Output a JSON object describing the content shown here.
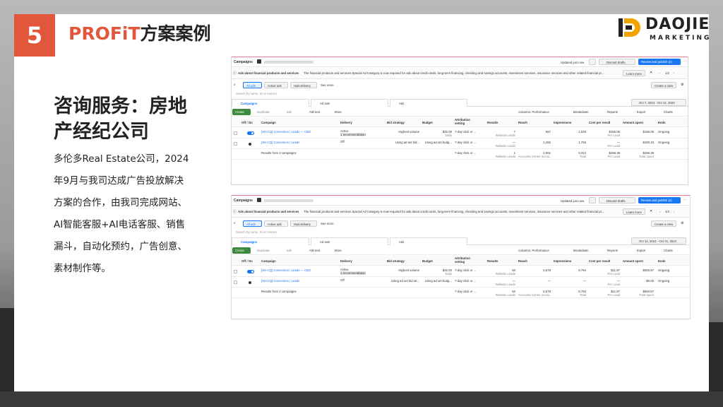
{
  "slide": {
    "number": "5",
    "title_brand": "PROFiT",
    "title_rest": "方案案例",
    "heading_line1": "咨询服务：房地",
    "heading_line2": "产经纪公司",
    "body_lines": [
      "多伦多Real  Estate公司，2024",
      "年9月与我司达成广告投放解决",
      "方案的合作，由我司完成网站、",
      "AI智能客服+AI电话客服、销售",
      "漏斗，自动化预约，广告创意、",
      "素材制作等。"
    ]
  },
  "logo": {
    "name": "DAOJIE",
    "sub": "MARKETING"
  },
  "colors": {
    "accent": "#e2573b",
    "primary": "#1877f2",
    "create": "#3b8a3e"
  },
  "screens": [
    {
      "header": {
        "title": "Campaigns",
        "updated": "Updated just now",
        "discard": "Discard drafts",
        "review": "Review and publish (2)"
      },
      "banner": {
        "bold": "Ads about financial products and services",
        "text": "The financial products and services Special Ad Category is now required for ads about credit cards, long-term financing, checking and savings accounts, investment services, insurance services and other related financial pr...",
        "learn": "Learn more",
        "page": "1/2"
      },
      "toolbar": {
        "all_ads": "All ads",
        "active_ads": "Active ads",
        "had_delivery": "Had delivery",
        "see_more": "See more",
        "create_view": "Create a view",
        "search": "Search by name, ID or metrics"
      },
      "tabs": [
        "Campaigns",
        "Ad sets",
        "Ads"
      ],
      "date": "Oct 7, 2024 - Oct 14, 2024",
      "actions": {
        "create": "Create",
        "duplicate": "Duplicate",
        "edit": "Edit",
        "ab": "A/B test",
        "more": "More",
        "columns": "Columns: Performance",
        "breakdown": "Breakdown",
        "reports": "Reports",
        "export": "Export",
        "charts": "Charts"
      },
      "columns": [
        "Off / On",
        "Campaign",
        "Delivery",
        "Bid strategy",
        "Budget",
        "Attribution setting",
        "Results",
        "Reach",
        "Impressions",
        "Cost per result",
        "Amount spent",
        "Ends"
      ],
      "rows": [
        {
          "campaign": "[SH-CQ] Conversion | Leads — CBO",
          "delivery": "Active",
          "delivery_sub": "1 recommendation",
          "bid": "Highest volume",
          "budget": "$32.00",
          "budget_sub": "Daily",
          "attr": "7-day click or ...",
          "results": "7",
          "results_sub": "Website Leads",
          "reach": "557",
          "impr": "1,529",
          "cpr": "$156.05",
          "cpr_sub": "Per Lead",
          "spent": "$156.05",
          "ends": "Ongoing"
        },
        {
          "campaign": "[SH-CQ] Conversion | Leads",
          "delivery": "Off",
          "delivery_sub": "",
          "bid": "Using ad set bid...",
          "budget": "Using ad set budg...",
          "budget_sub": "",
          "attr": "7-day click or ...",
          "results": "—",
          "results_sub": "Website Leads",
          "reach": "1,492",
          "impr": "1,783",
          "cpr": "—",
          "cpr_sub": "Per Lead",
          "spent": "$100.33",
          "ends": "Ongoing"
        }
      ],
      "total": {
        "label": "Results from 2 campaigns",
        "attr": "7-day click or ...",
        "results": "1",
        "results_sub": "Website Leads",
        "reach": "2,001",
        "reach_sub": "Accounts Center accou...",
        "impr": "3,312",
        "impr_sub": "Total",
        "cpr": "$256.38",
        "cpr_sub": "Per Lead",
        "spent": "$256.38",
        "spent_sub": "Total spent"
      }
    },
    {
      "header": {
        "title": "Campaigns",
        "updated": "Updated just now",
        "discard": "Discard drafts",
        "review": "Review and publish (2)"
      },
      "banner": {
        "bold": "Ads about financial products and services",
        "text": "The financial products and services Special Ad Category is now required for ads about credit cards, long-term financing, checking and savings accounts, investment services, insurance services and other related financial pr...",
        "learn": "Learn more",
        "page": "1/2"
      },
      "toolbar": {
        "all_ads": "All ads",
        "active_ads": "Active ads",
        "had_delivery": "Had delivery",
        "see_more": "See more",
        "create_view": "Create a view",
        "search": "Search by name, ID or metrics"
      },
      "tabs": [
        "Campaigns",
        "Ad sets",
        "Ads"
      ],
      "date": "Oct 14, 2024 - Oct 31, 2024",
      "actions": {
        "create": "Create",
        "duplicate": "Duplicate",
        "edit": "Edit",
        "ab": "A/B test",
        "more": "More",
        "columns": "Columns: Performance",
        "breakdown": "Breakdown",
        "reports": "Reports",
        "export": "Export",
        "charts": "Charts"
      },
      "columns": [
        "Off / On",
        "Campaign",
        "Delivery",
        "Bid strategy",
        "Budget",
        "Attribution setting",
        "Results",
        "Reach",
        "Impressions",
        "Cost per result",
        "Amount spent",
        "Ends"
      ],
      "rows": [
        {
          "campaign": "[SH-CQ] Conversion | Leads — CBO",
          "delivery": "Active",
          "delivery_sub": "1 recommendation",
          "bid": "Highest volume",
          "budget": "$32.00",
          "budget_sub": "Daily",
          "attr": "7-day click or ...",
          "results": "50",
          "results_sub": "Website Leads",
          "reach": "5,578",
          "impr": "8,794",
          "cpr": "$11.87",
          "cpr_sub": "Per Lead",
          "spent": "$593.57",
          "ends": "Ongoing"
        },
        {
          "campaign": "[SH-CQ] Conversion | Leads",
          "delivery": "Off",
          "delivery_sub": "",
          "bid": "Using ad set bid str...",
          "budget": "Using ad set budg...",
          "budget_sub": "",
          "attr": "7-day click or ...",
          "results": "—",
          "results_sub": "Website Leads",
          "reach": "—",
          "impr": "—",
          "cpr": "—",
          "cpr_sub": "Per Lead",
          "spent": "$0.00",
          "ends": "Ongoing"
        }
      ],
      "total": {
        "label": "Results from 2 campaigns",
        "attr": "7-day click or ...",
        "results": "50",
        "results_sub": "Website Leads",
        "reach": "5,578",
        "reach_sub": "Accounts Center accou...",
        "impr": "8,794",
        "impr_sub": "Total",
        "cpr": "$11.87",
        "cpr_sub": "Per Lead",
        "spent": "$593.57",
        "spent_sub": "Total spent"
      }
    }
  ]
}
